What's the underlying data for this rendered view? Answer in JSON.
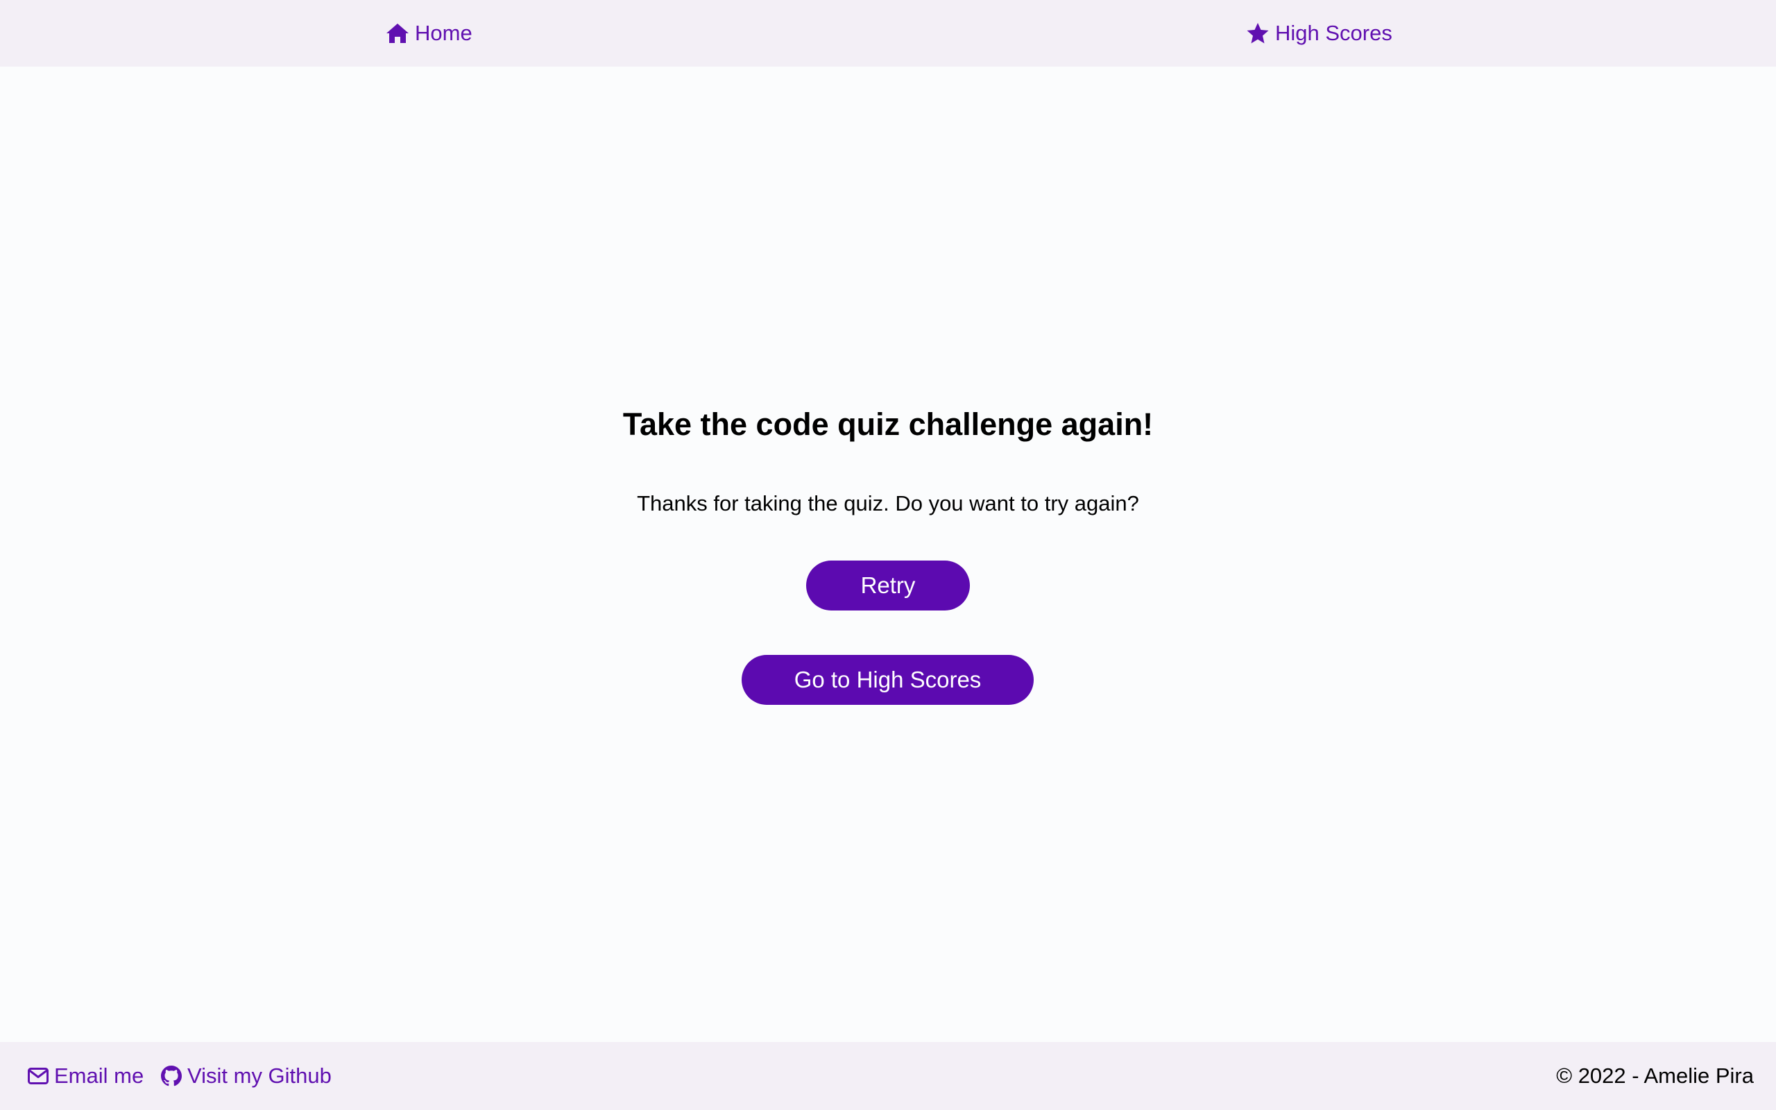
{
  "nav": {
    "home_label": "Home",
    "home_icon": "home-icon",
    "scores_label": "High Scores",
    "scores_icon": "star-icon"
  },
  "main": {
    "title": "Take the code quiz challenge again!",
    "subtitle": "Thanks for taking the quiz. Do you want to try again?",
    "retry_label": "Retry",
    "scores_button_label": "Go to High Scores"
  },
  "footer": {
    "email_label": "Email me",
    "email_icon": "envelope-icon",
    "github_label": "Visit my Github",
    "github_icon": "github-icon",
    "copyright": "© 2022 - Amelie Pira"
  },
  "colors": {
    "accent": "#5c0ab0",
    "link": "#6010b0",
    "bar_background": "#f3eff6",
    "page_background": "#fbfcfd"
  }
}
